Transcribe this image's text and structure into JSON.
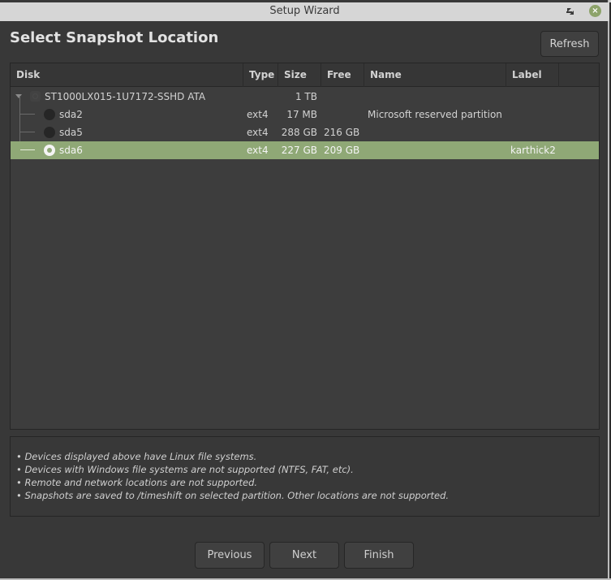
{
  "window": {
    "title": "Setup Wizard",
    "controls": {
      "minimize_icon": "minimize-icon",
      "maximize_icon": "maximize-icon",
      "close_icon": "close-icon",
      "close_glyph": "×",
      "maximize_glyph": "⬉"
    },
    "accent_color": "#8fa876"
  },
  "page": {
    "title": "Select Snapshot Location",
    "refresh_label": "Refresh"
  },
  "table": {
    "columns": [
      "Disk",
      "Type",
      "Size",
      "Free",
      "Name",
      "Label",
      ""
    ],
    "disk": {
      "name": "ST1000LX015-1U7172-SSHD ATA",
      "size": "1 TB",
      "expanded": true
    },
    "partitions": [
      {
        "device": "sda2",
        "type": "ext4",
        "size": "17 MB",
        "free": "",
        "name": "Microsoft reserved partition",
        "label": "",
        "selected": false
      },
      {
        "device": "sda5",
        "type": "ext4",
        "size": "288 GB",
        "free": "216 GB",
        "name": "",
        "label": "",
        "selected": false
      },
      {
        "device": "sda6",
        "type": "ext4",
        "size": "227 GB",
        "free": "209 GB",
        "name": "",
        "label": "karthick2",
        "selected": true
      }
    ]
  },
  "info": [
    "• Devices displayed above have Linux file systems.",
    "• Devices with Windows file systems are not supported (NTFS, FAT, etc).",
    "• Remote and network locations are not supported.",
    "• Snapshots are saved to /timeshift on selected partition. Other locations are not supported."
  ],
  "buttons": {
    "previous": "Previous",
    "next": "Next",
    "finish": "Finish"
  }
}
